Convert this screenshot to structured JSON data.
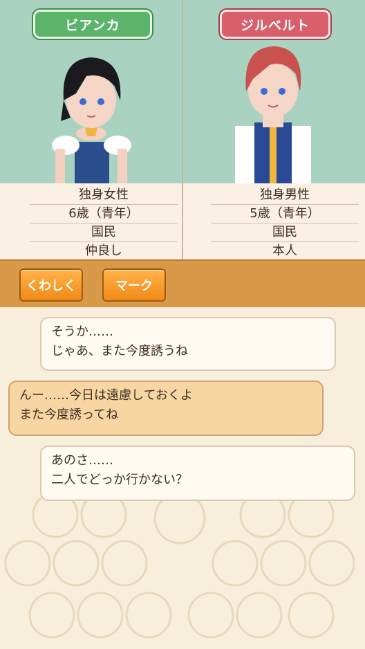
{
  "left_character": {
    "name": "ビアンカ",
    "info": [
      "独身女性",
      "6歳（青年）",
      "国民",
      "仲良し"
    ]
  },
  "right_character": {
    "name": "ジルベルト",
    "info": [
      "独身男性",
      "5歳（青年）",
      "国民",
      "本人"
    ]
  },
  "buttons": {
    "detail": "くわしく",
    "mark": "マーク"
  },
  "messages": [
    {
      "line1": "そうか……",
      "line2": "じゃあ、また今度誘うね"
    },
    {
      "line1": "んー……今日は遠慮しておくよ",
      "line2": "また今度誘ってね"
    },
    {
      "line1": "あのさ……",
      "line2": "二人でどっか行かない？"
    }
  ],
  "colors": {
    "left_tag": "#5cb46a",
    "right_tag": "#d95f6a",
    "button": "#f08a18"
  }
}
